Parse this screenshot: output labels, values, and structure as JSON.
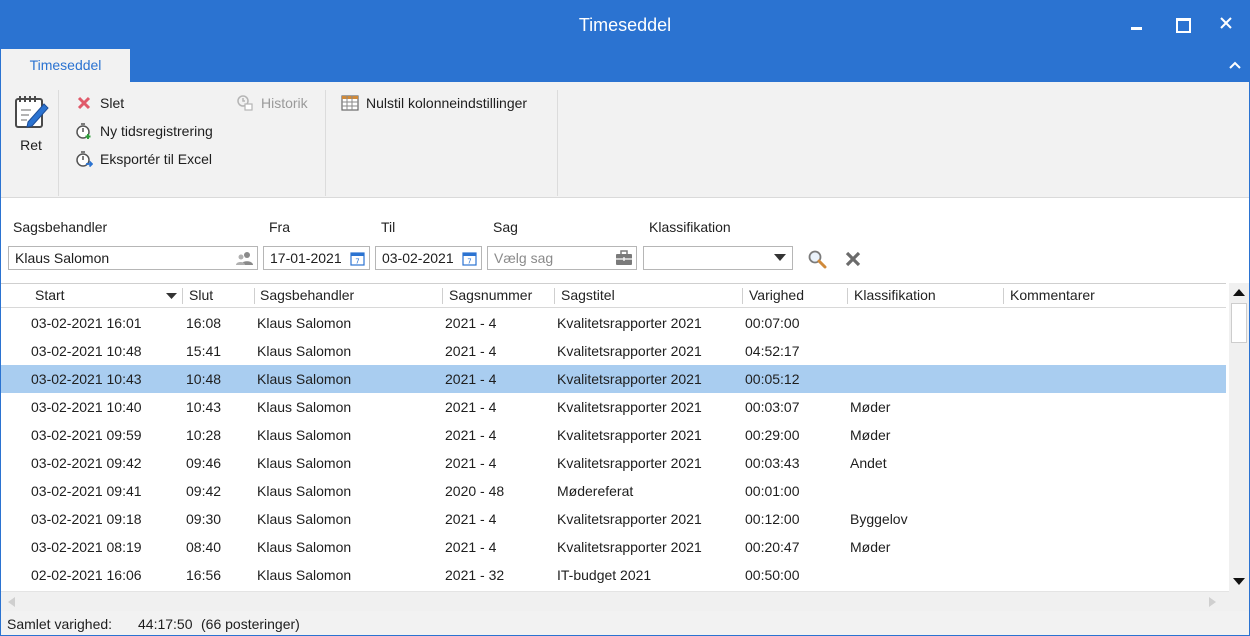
{
  "window": {
    "title": "Timeseddel"
  },
  "ribbon": {
    "tab_label": "Timeseddel",
    "edit_label": "Ret",
    "delete_label": "Slet",
    "new_time_label": "Ny tidsregistrering",
    "export_label": "Eksportér til Excel",
    "history_label": "Historik",
    "reset_columns_label": "Nulstil kolonneindstillinger"
  },
  "filters": {
    "caseworker_label": "Sagsbehandler",
    "caseworker_value": "Klaus Salomon",
    "from_label": "Fra",
    "from_value": "17-01-2021",
    "to_label": "Til",
    "to_value": "03-02-2021",
    "case_label": "Sag",
    "case_placeholder": "Vælg sag",
    "classification_label": "Klassifikation",
    "classification_value": ""
  },
  "grid": {
    "columns": [
      "Start",
      "Slut",
      "Sagsbehandler",
      "Sagsnummer",
      "Sagstitel",
      "Varighed",
      "Klassifikation",
      "Kommentarer"
    ],
    "rows": [
      [
        "03-02-2021 16:01",
        "16:08",
        "Klaus Salomon",
        "2021 - 4",
        "Kvalitetsrapporter 2021",
        "00:07:00",
        "",
        ""
      ],
      [
        "03-02-2021 10:48",
        "15:41",
        "Klaus Salomon",
        "2021 - 4",
        "Kvalitetsrapporter 2021",
        "04:52:17",
        "",
        ""
      ],
      [
        "03-02-2021 10:43",
        "10:48",
        "Klaus Salomon",
        "2021 - 4",
        "Kvalitetsrapporter 2021",
        "00:05:12",
        "",
        ""
      ],
      [
        "03-02-2021 10:40",
        "10:43",
        "Klaus Salomon",
        "2021 - 4",
        "Kvalitetsrapporter 2021",
        "00:03:07",
        "Møder",
        ""
      ],
      [
        "03-02-2021 09:59",
        "10:28",
        "Klaus Salomon",
        "2021 - 4",
        "Kvalitetsrapporter 2021",
        "00:29:00",
        "Møder",
        ""
      ],
      [
        "03-02-2021 09:42",
        "09:46",
        "Klaus Salomon",
        "2021 - 4",
        "Kvalitetsrapporter 2021",
        "00:03:43",
        "Andet",
        ""
      ],
      [
        "03-02-2021 09:41",
        "09:42",
        "Klaus Salomon",
        "2020 - 48",
        "Mødereferat",
        "00:01:00",
        "",
        ""
      ],
      [
        "03-02-2021 09:18",
        "09:30",
        "Klaus Salomon",
        "2021 - 4",
        "Kvalitetsrapporter 2021",
        "00:12:00",
        "Byggelov",
        ""
      ],
      [
        "03-02-2021 08:19",
        "08:40",
        "Klaus Salomon",
        "2021 - 4",
        "Kvalitetsrapporter 2021",
        "00:20:47",
        "Møder",
        ""
      ],
      [
        "02-02-2021 16:06",
        "16:56",
        "Klaus Salomon",
        "2021 - 32",
        "IT-budget 2021",
        "00:50:00",
        "",
        ""
      ]
    ],
    "selected_row": 2
  },
  "status": {
    "total_label": "Samlet varighed:",
    "total_value": "44:17:50",
    "count_text": "(66 posteringer)"
  },
  "colors": {
    "accent": "#2b73d1",
    "selected_row": "#a9cdf0",
    "ribbon_bg": "#f2f2f2"
  }
}
